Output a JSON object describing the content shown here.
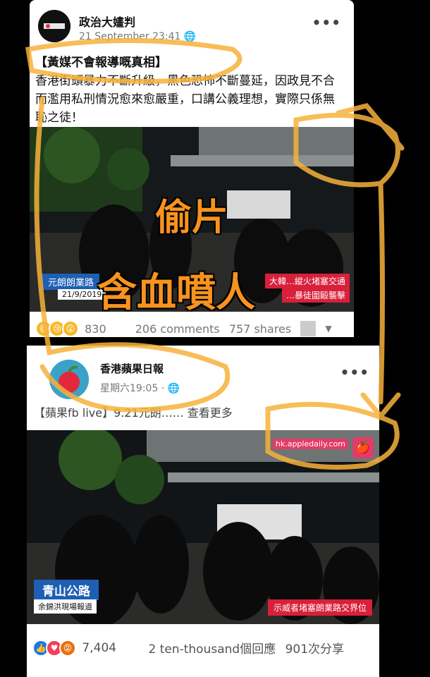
{
  "post1": {
    "page_name": "政治大嫿判",
    "timestamp": "21 September 23:41",
    "menu": "•••",
    "headline": "【黃媒不會報導嘅真相】",
    "body": "香港街頭暴力不斷升級，黑色恐怖不斷蔓延，因政見不合而濫用私刑情況愈來愈嚴重，口講公義理想，實際只係無恥之徒！",
    "video_left_caption": "元朗朗業路",
    "video_date": "21/9/2019",
    "video_right_caption_1": "大韓…縱火堵塞交通",
    "video_right_caption_2": "…暴徒圍毆襲擊",
    "reactions": "830",
    "comments": "206 comments",
    "shares": "757 shares"
  },
  "post2": {
    "page_name": "香港蘋果日報",
    "timestamp": "星期六19:05 ·",
    "menu": "•••",
    "caption": "【蘋果fb live】9.21元朗…… 查看更多",
    "url_tag": "hk.appledaily.com",
    "location": "青山公路",
    "reporter": "余錦洪現場報道",
    "right_caption": "示威者堵塞朗業路交界位",
    "reactions": "7,404",
    "comments": "2 ten-thousand個回應",
    "shares": "901次分享"
  },
  "overlay": {
    "line1": "偷片",
    "line2": "含血噴人"
  },
  "colors": {
    "annotation": "#f7b23b",
    "apple_red": "#e33b67",
    "like_blue": "#1877f2"
  }
}
